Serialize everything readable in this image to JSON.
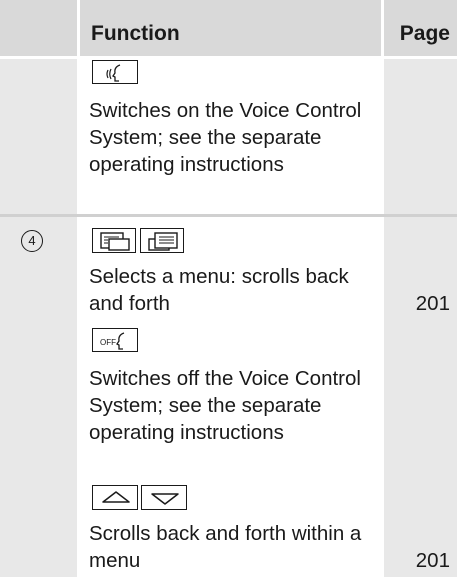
{
  "header": {
    "function_label": "Function",
    "page_label": "Page"
  },
  "rows": [
    {
      "number": "",
      "entries": [
        {
          "icons": [
            "voice-on-icon"
          ],
          "text": "Switches on the Voice Control System; see the separate operating instructions",
          "page": ""
        }
      ]
    },
    {
      "number": "4",
      "entries": [
        {
          "icons": [
            "display-menu-left-icon",
            "display-menu-right-icon"
          ],
          "text": "Selects a menu: scrolls back and forth",
          "page": "201"
        },
        {
          "icons": [
            "voice-off-icon"
          ],
          "icon_text": "OFF",
          "text": "Switches off the Voice Control System; see the separate operating instructions",
          "page": ""
        },
        {
          "icons": [
            "arrow-up-icon",
            "arrow-down-icon"
          ],
          "text": "Scrolls back and forth within a menu",
          "page": "201"
        }
      ]
    }
  ]
}
